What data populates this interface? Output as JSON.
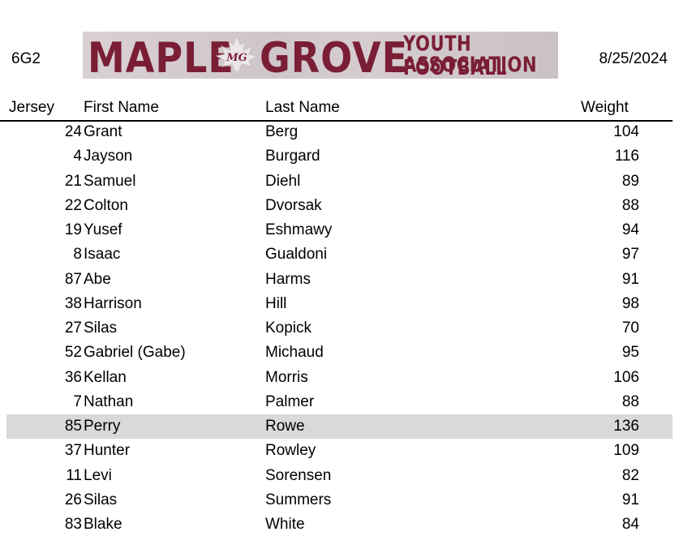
{
  "header": {
    "team_code": "6G2",
    "date": "8/25/2024",
    "banner": {
      "word1": "MAPLE",
      "word2": "GROVE",
      "line1": "YOUTH FOOTBALL",
      "line2": "ASSOCIATION",
      "emblem_text": "MG",
      "brand_color": "#7a1e35"
    }
  },
  "table": {
    "columns": [
      "Jersey",
      "First Name",
      "Last Name",
      "Weight"
    ],
    "highlight_color": "#d9d9d9",
    "rows": [
      {
        "jersey": "24",
        "first": "Grant",
        "last": "Berg",
        "weight": "104"
      },
      {
        "jersey": "4",
        "first": "Jayson",
        "last": "Burgard",
        "weight": "116"
      },
      {
        "jersey": "21",
        "first": "Samuel",
        "last": "Diehl",
        "weight": "89"
      },
      {
        "jersey": "22",
        "first": "Colton",
        "last": "Dvorsak",
        "weight": "88"
      },
      {
        "jersey": "19",
        "first": "Yusef",
        "last": "Eshmawy",
        "weight": "94"
      },
      {
        "jersey": "8",
        "first": "Isaac",
        "last": "Gualdoni",
        "weight": "97"
      },
      {
        "jersey": "87",
        "first": "Abe",
        "last": "Harms",
        "weight": "91"
      },
      {
        "jersey": "38",
        "first": "Harrison",
        "last": "Hill",
        "weight": "98"
      },
      {
        "jersey": "27",
        "first": "Silas",
        "last": "Kopick",
        "weight": "70"
      },
      {
        "jersey": "52",
        "first": "Gabriel (Gabe)",
        "last": "Michaud",
        "weight": "95"
      },
      {
        "jersey": "36",
        "first": "Kellan",
        "last": "Morris",
        "weight": "106"
      },
      {
        "jersey": "7",
        "first": "Nathan",
        "last": "Palmer",
        "weight": "88"
      },
      {
        "jersey": "85",
        "first": "Perry",
        "last": "Rowe",
        "weight": "136",
        "highlighted": true
      },
      {
        "jersey": "37",
        "first": "Hunter",
        "last": "Rowley",
        "weight": "109"
      },
      {
        "jersey": "11",
        "first": "Levi",
        "last": "Sorensen",
        "weight": "82"
      },
      {
        "jersey": "26",
        "first": "Silas",
        "last": "Summers",
        "weight": "91"
      },
      {
        "jersey": "83",
        "first": "Blake",
        "last": "White",
        "weight": "84"
      }
    ]
  }
}
